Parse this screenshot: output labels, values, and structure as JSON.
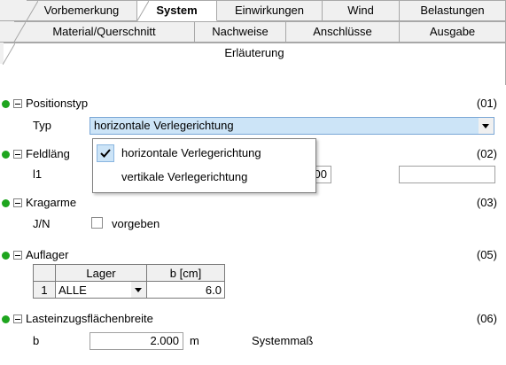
{
  "tabs_row1": [
    {
      "label": "Vorbemerkung",
      "active": false
    },
    {
      "label": "System",
      "active": true
    },
    {
      "label": "Einwirkungen",
      "active": false
    },
    {
      "label": "Wind",
      "active": false
    },
    {
      "label": "Belastungen",
      "active": false
    }
  ],
  "tabs_row2": [
    {
      "label": "Material/Querschnitt"
    },
    {
      "label": "Nachweise"
    },
    {
      "label": "Anschlüsse"
    },
    {
      "label": "Ausgabe"
    }
  ],
  "tabs_row3": [
    {
      "label": "Erläuterung"
    }
  ],
  "positionstyp": {
    "title": "Positionstyp",
    "code": "(01)",
    "label": "Typ",
    "value": "horizontale Verlegerichtung"
  },
  "dropdown": {
    "options": [
      {
        "label": "horizontale Verlegerichtung",
        "selected": true
      },
      {
        "label": "vertikale Verlegerichtung",
        "selected": false
      }
    ]
  },
  "feldlaenge": {
    "title": "Feldläng",
    "code": "(02)",
    "label": "l1",
    "value_fragment": "00",
    "extra_value": ""
  },
  "kragarme": {
    "title": "Kragarme",
    "code": "(03)",
    "label": "J/N",
    "checkbox_label": "vorgeben",
    "checked": false
  },
  "auflager": {
    "title": "Auflager",
    "code": "(05)",
    "headers": [
      "Lager",
      "b [cm]"
    ],
    "rows": [
      {
        "index": "1",
        "lager": "ALLE",
        "b": "6.0"
      }
    ]
  },
  "lasteinzug": {
    "title": "Lasteinzugsflächenbreite",
    "code": "(06)",
    "label": "b",
    "value": "2.000",
    "unit": "m",
    "note": "Systemmaß"
  },
  "colors": {
    "status_dot": "#1ea51e",
    "selection": "#cce4f7"
  }
}
